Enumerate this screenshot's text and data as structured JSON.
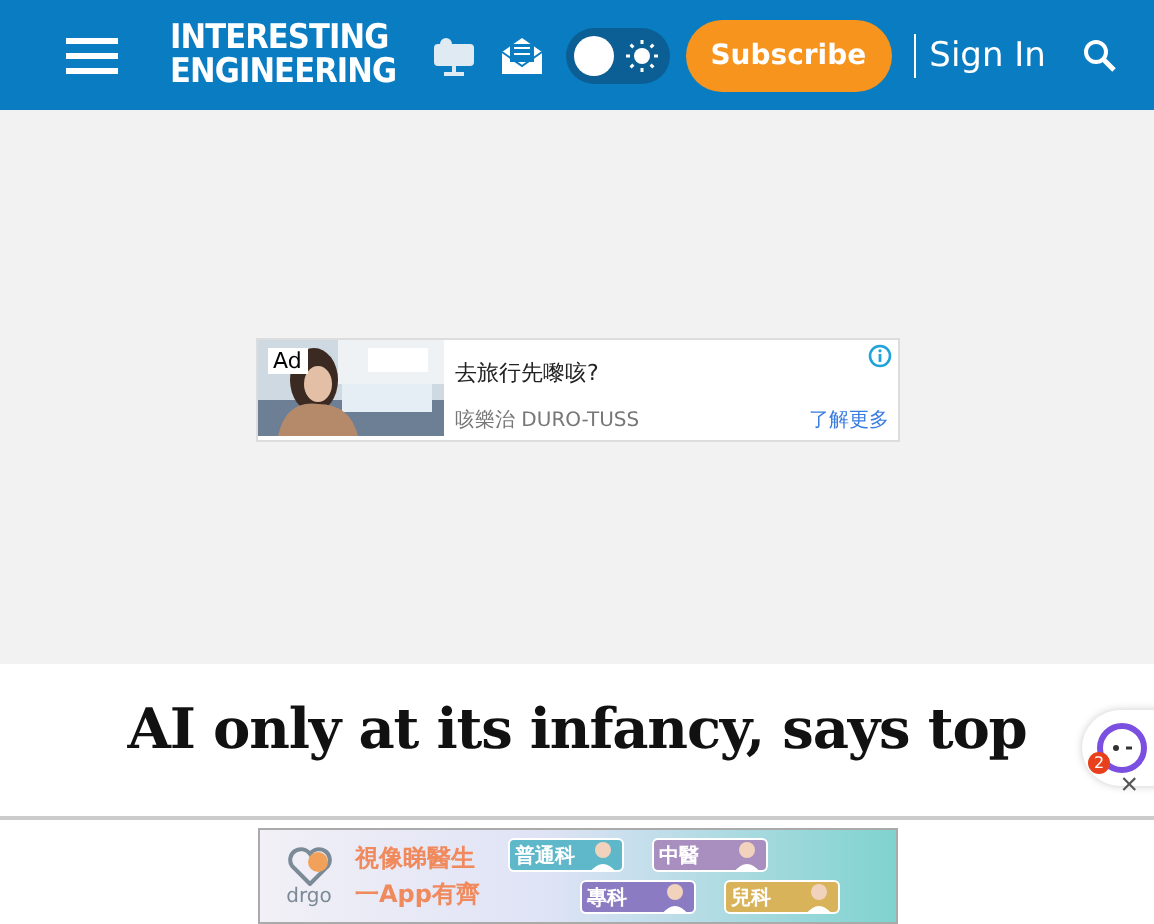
{
  "header": {
    "logo": [
      "INTERESTING",
      "ENGINEERING"
    ],
    "theme_toggle": {
      "on": false
    },
    "subscribe": "Subscribe",
    "sign_in": "Sign In"
  },
  "top_ad": {
    "badge": "Ad",
    "title": "去旅行先嚟咳?",
    "advertiser": "咳樂治 DURO-TUSS",
    "link": "了解更多"
  },
  "article": {
    "headline": "AI only at its infancy, says top"
  },
  "chat_widget": {
    "badge": "2",
    "close": "×"
  },
  "bottom_ad": {
    "brand": "drgo",
    "lines": [
      "視像睇醫生",
      "一App有齊"
    ],
    "tags": [
      {
        "label": "普通科",
        "color": "#5fb8c9"
      },
      {
        "label": "中醫",
        "color": "#a98fc0"
      },
      {
        "label": "專科",
        "color": "#8a7bc2"
      },
      {
        "label": "兒科",
        "color": "#d9b35a"
      }
    ]
  }
}
